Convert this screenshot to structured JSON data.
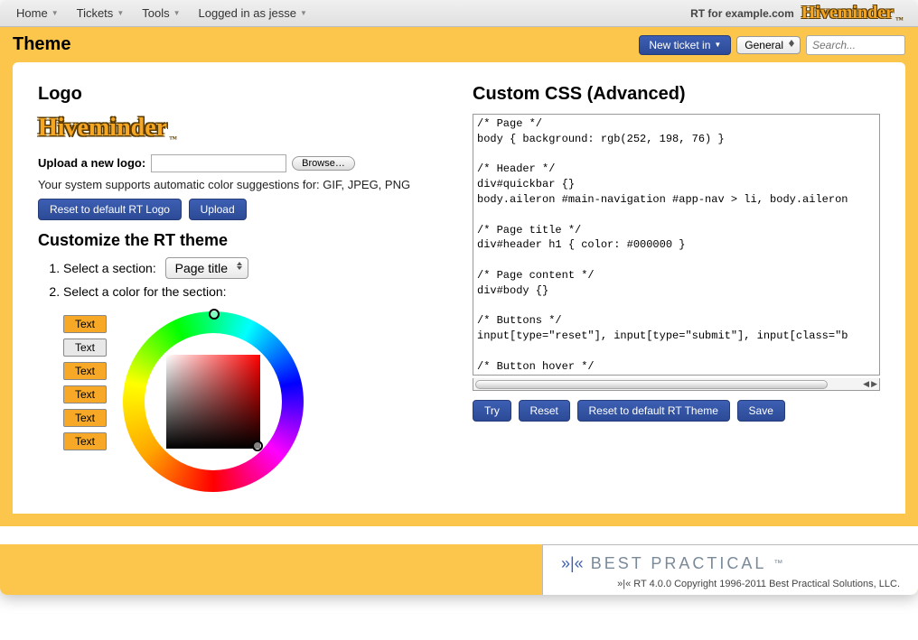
{
  "menubar": {
    "items": [
      "Home",
      "Tickets",
      "Tools",
      "Logged in as jesse"
    ],
    "rt_label": "RT for example.com",
    "logo_text": "Hiveminder"
  },
  "header": {
    "title": "Theme",
    "new_ticket_label": "New ticket in",
    "queue_select": "General",
    "search_placeholder": "Search..."
  },
  "logo_section": {
    "heading": "Logo",
    "logo_text": "Hiveminder",
    "upload_label": "Upload a new logo:",
    "browse_label": "Browse…",
    "help_text": "Your system supports automatic color suggestions for: GIF, JPEG, PNG",
    "reset_label": "Reset to default RT Logo",
    "upload_btn": "Upload"
  },
  "customize": {
    "heading": "Customize the RT theme",
    "step1": "Select a section:",
    "section_select": "Page title",
    "step2": "Select a color for the section:",
    "swatches": [
      "Text",
      "Text",
      "Text",
      "Text",
      "Text",
      "Text"
    ]
  },
  "css": {
    "heading": "Custom CSS (Advanced)",
    "content": "/* Page */\nbody { background: rgb(252, 198, 76) }\n\n/* Header */\ndiv#quickbar {}\nbody.aileron #main-navigation #app-nav > li, body.aileron\n\n/* Page title */\ndiv#header h1 { color: #000000 }\n\n/* Page content */\ndiv#body {}\n\n/* Buttons */\ninput[type=\"reset\"], input[type=\"submit\"], input[class=\"b\n\n/* Button hover */\ninput[type=\"reset\"]:hover, input[type=\"submit\"]:hover, in",
    "try_label": "Try",
    "reset_label": "Reset",
    "reset_theme_label": "Reset to default RT Theme",
    "save_label": "Save"
  },
  "footer": {
    "brand": "BEST PRACTICAL",
    "copyright": "»|« RT 4.0.0 Copyright 1996-2011 Best Practical Solutions, LLC."
  }
}
